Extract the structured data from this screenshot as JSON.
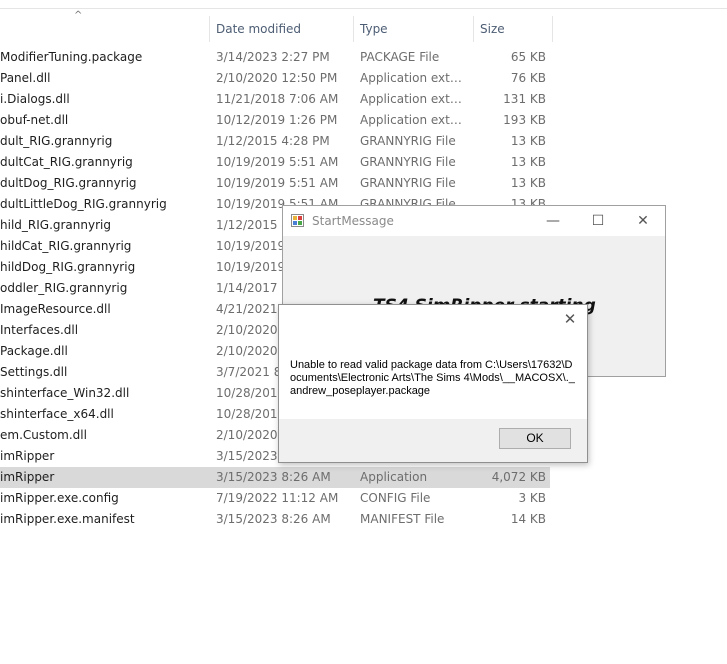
{
  "columns": {
    "date": "Date modified",
    "type": "Type",
    "size": "Size"
  },
  "files": [
    {
      "name": "ModifierTuning.package",
      "date": "3/14/2023 2:27 PM",
      "type": "PACKAGE File",
      "size": "65 KB"
    },
    {
      "name": "Panel.dll",
      "date": "2/10/2020 12:50 PM",
      "type": "Application exten...",
      "size": "76 KB"
    },
    {
      "name": "i.Dialogs.dll",
      "date": "11/21/2018 7:06 AM",
      "type": "Application exten...",
      "size": "131 KB"
    },
    {
      "name": "obuf-net.dll",
      "date": "10/12/2019 1:26 PM",
      "type": "Application exten...",
      "size": "193 KB"
    },
    {
      "name": "dult_RIG.grannyrig",
      "date": "1/12/2015 4:28 PM",
      "type": "GRANNYRIG File",
      "size": "13 KB"
    },
    {
      "name": "dultCat_RIG.grannyrig",
      "date": "10/19/2019 5:51 AM",
      "type": "GRANNYRIG File",
      "size": "13 KB"
    },
    {
      "name": "dultDog_RIG.grannyrig",
      "date": "10/19/2019 5:51 AM",
      "type": "GRANNYRIG File",
      "size": "13 KB"
    },
    {
      "name": "dultLittleDog_RIG.grannyrig",
      "date": "10/19/2019 5:51 AM",
      "type": "GRANNYRIG File",
      "size": "13 KB"
    },
    {
      "name": "hild_RIG.grannyrig",
      "date": "1/12/2015 4:",
      "type": "",
      "size": ""
    },
    {
      "name": "hildCat_RIG.grannyrig",
      "date": "10/19/2019 5",
      "type": "",
      "size": ""
    },
    {
      "name": "hildDog_RIG.grannyrig",
      "date": "10/19/2019 5",
      "type": "",
      "size": ""
    },
    {
      "name": "oddler_RIG.grannyrig",
      "date": "1/14/2017 7:",
      "type": "",
      "size": ""
    },
    {
      "name": "ImageResource.dll",
      "date": "4/21/2021 8",
      "type": "",
      "size": ""
    },
    {
      "name": "Interfaces.dll",
      "date": "2/10/2020 1",
      "type": "",
      "size": ""
    },
    {
      "name": "Package.dll",
      "date": "2/10/2020 1",
      "type": "",
      "size": ""
    },
    {
      "name": "Settings.dll",
      "date": "3/7/2021 8:2",
      "type": "",
      "size": ""
    },
    {
      "name": "shinterface_Win32.dll",
      "date": "10/28/2019",
      "type": "",
      "size": ""
    },
    {
      "name": "shinterface_x64.dll",
      "date": "10/28/2019",
      "type": "",
      "size": ""
    },
    {
      "name": "em.Custom.dll",
      "date": "2/10/2020 1",
      "type": "",
      "size": ""
    },
    {
      "name": "imRipper",
      "date": "3/15/2023",
      "type": "Applica",
      "size": ""
    },
    {
      "name": "imRipper",
      "date": "3/15/2023 8:26 AM",
      "type": "Application",
      "size": "4,072 KB",
      "selected": true
    },
    {
      "name": "imRipper.exe.config",
      "date": "7/19/2022 11:12 AM",
      "type": "CONFIG File",
      "size": "3 KB"
    },
    {
      "name": "imRipper.exe.manifest",
      "date": "3/15/2023 8:26 AM",
      "type": "MANIFEST File",
      "size": "14 KB"
    }
  ],
  "start_window": {
    "title": "StartMessage",
    "minimize": "—",
    "maximize": "☐",
    "close": "✕",
    "body_text": "TS4 SimRipper starting"
  },
  "message_box": {
    "close": "✕",
    "text": "Unable to read valid package data from C:\\Users\\17632\\Documents\\Electronic Arts\\The Sims 4\\Mods\\__MACOSX\\._andrew_poseplayer.package",
    "ok": "OK"
  }
}
